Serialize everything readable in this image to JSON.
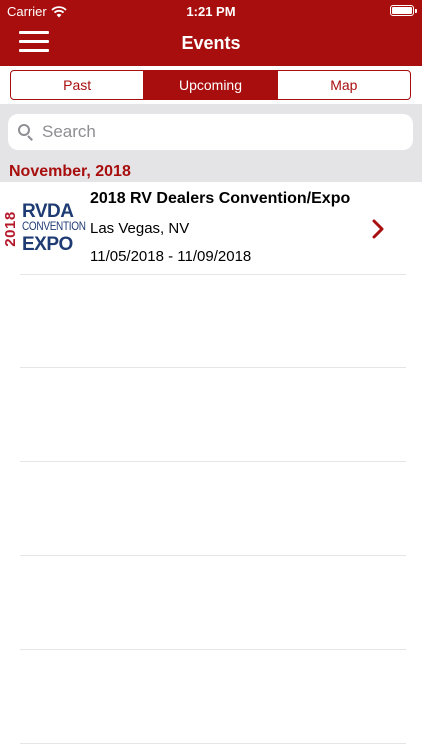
{
  "status_bar": {
    "carrier": "Carrier",
    "time": "1:21 PM",
    "icons": [
      "wifi-icon",
      "battery-icon"
    ]
  },
  "nav": {
    "title": "Events",
    "menu_icon": "hamburger-menu-icon"
  },
  "tabs": [
    {
      "label": "Past",
      "active": false
    },
    {
      "label": "Upcoming",
      "active": true
    },
    {
      "label": "Map",
      "active": false
    }
  ],
  "search": {
    "placeholder": "Search",
    "value": ""
  },
  "section": {
    "header": "November, 2018"
  },
  "events": [
    {
      "title": "2018 RV Dealers Convention/Expo",
      "location": "Las Vegas, NV",
      "dates": "11/05/2018 - 11/09/2018",
      "logo": {
        "year": "2018",
        "line1": "RVDA",
        "line2": "CONVENTION",
        "line3": "EXPO"
      }
    }
  ],
  "colors": {
    "brand": "#a80e0e",
    "search_background": "#e4e4e6",
    "logo_navy": "#1f3b73",
    "logo_red": "#b5182a"
  }
}
